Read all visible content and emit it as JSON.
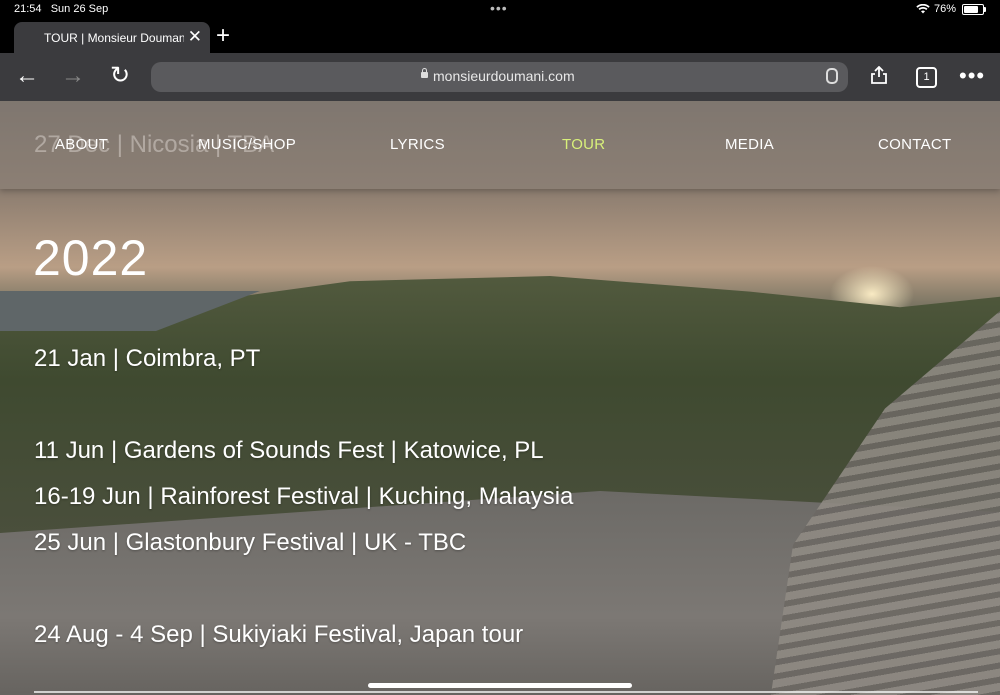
{
  "status": {
    "time": "21:54",
    "date": "Sun 26 Sep",
    "battery": "76%"
  },
  "tab": {
    "title": "TOUR | Monsieur Doumani"
  },
  "toolbar": {
    "url": "monsieurdoumani.com",
    "tab_count": "1"
  },
  "nav": {
    "items": [
      "ABOUT",
      "MUSIC/SHOP",
      "LYRICS",
      "TOUR",
      "MEDIA",
      "CONTACT"
    ],
    "active": "TOUR",
    "active_color": "#d8f07a"
  },
  "ghost_text": "27 Dec | Nicosia | TBA",
  "tour": {
    "year": "2022",
    "events": [
      "21 Jan | Coimbra, PT",
      "11 Jun | Gardens of Sounds Fest | Katowice, PL",
      "16-19 Jun | Rainforest Festival | Kuching, Malaysia",
      "25 Jun | Glastonbury Festival | UK  - TBC",
      "24 Aug - 4 Sep | Sukiyiaki Festival, Japan tour"
    ]
  }
}
